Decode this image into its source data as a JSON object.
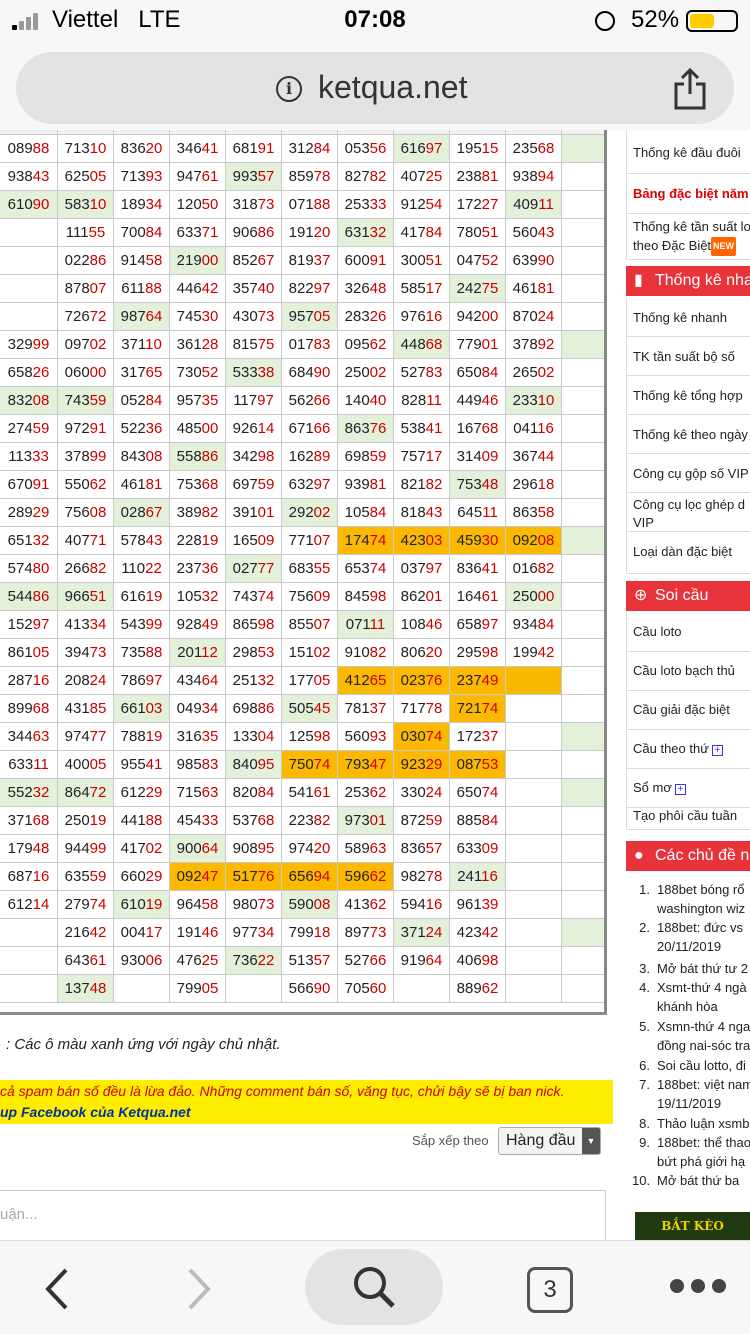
{
  "status_bar": {
    "carrier": "Viettel",
    "network": "LTE",
    "time": "07:08",
    "battery": "52%"
  },
  "url_bar": {
    "host": "ketqua.net"
  },
  "grid_rows": [
    [
      "08988",
      "71310",
      "83620",
      "34641",
      "68191",
      "31284",
      "05356",
      "61697",
      "19515",
      "23568",
      ""
    ],
    [
      "93843",
      "62505",
      "71393",
      "94761",
      "99357",
      "85978",
      "82782",
      "40725",
      "23881",
      "93894",
      ""
    ],
    [
      "61090",
      "58310",
      "18934",
      "12050",
      "31873",
      "07188",
      "25333",
      "91254",
      "17227",
      "40911",
      ""
    ],
    [
      "",
      "11155",
      "70084",
      "63371",
      "90686",
      "19120",
      "63132",
      "41784",
      "78051",
      "56043",
      ""
    ],
    [
      "",
      "02286",
      "91458",
      "21900",
      "85267",
      "81937",
      "60091",
      "30051",
      "04752",
      "63990",
      ""
    ],
    [
      "",
      "87807",
      "61188",
      "44642",
      "35740",
      "82297",
      "32648",
      "58517",
      "24275",
      "46181",
      ""
    ],
    [
      "",
      "72672",
      "98764",
      "74530",
      "43073",
      "95705",
      "28326",
      "97616",
      "94200",
      "87024",
      ""
    ],
    [
      "32999",
      "09702",
      "37110",
      "36128",
      "81575",
      "01783",
      "09562",
      "44868",
      "77901",
      "37892",
      ""
    ],
    [
      "65826",
      "06000",
      "31765",
      "73052",
      "53338",
      "68490",
      "25002",
      "52783",
      "65084",
      "26502",
      ""
    ],
    [
      "83208",
      "74359",
      "05284",
      "95735",
      "11797",
      "56266",
      "14040",
      "82811",
      "44946",
      "23310",
      ""
    ],
    [
      "27459",
      "97291",
      "52236",
      "48500",
      "92614",
      "67166",
      "86376",
      "53841",
      "16768",
      "04116",
      ""
    ],
    [
      "11333",
      "37899",
      "84308",
      "55886",
      "34298",
      "16289",
      "69859",
      "75717",
      "31409",
      "36744",
      ""
    ],
    [
      "67091",
      "55062",
      "46181",
      "75368",
      "69759",
      "63297",
      "93981",
      "82182",
      "75348",
      "29618",
      ""
    ],
    [
      "28929",
      "75608",
      "02867",
      "38982",
      "39101",
      "29202",
      "10584",
      "81843",
      "64511",
      "86358",
      ""
    ],
    [
      "65132",
      "40771",
      "57843",
      "22819",
      "16509",
      "77107",
      "17474",
      "42303",
      "45930",
      "09208",
      ""
    ],
    [
      "57480",
      "26682",
      "11022",
      "23736",
      "02777",
      "68355",
      "65374",
      "03797",
      "83641",
      "01682",
      ""
    ],
    [
      "54486",
      "96651",
      "61619",
      "10532",
      "74374",
      "75609",
      "84598",
      "86201",
      "16461",
      "25000",
      ""
    ],
    [
      "15297",
      "41334",
      "54399",
      "92849",
      "86598",
      "85507",
      "07111",
      "10846",
      "65897",
      "93484",
      ""
    ],
    [
      "86105",
      "39473",
      "73588",
      "20112",
      "29853",
      "15102",
      "91082",
      "80620",
      "29598",
      "19942",
      ""
    ],
    [
      "28716",
      "20824",
      "78697",
      "43464",
      "25132",
      "17705",
      "41265",
      "02376",
      "23749",
      "",
      ""
    ],
    [
      "89968",
      "43185",
      "66103",
      "04934",
      "69886",
      "50545",
      "78137",
      "71778",
      "72174",
      "",
      ""
    ],
    [
      "34463",
      "97477",
      "78819",
      "31635",
      "13304",
      "12598",
      "56093",
      "03074",
      "17237",
      "",
      ""
    ],
    [
      "63311",
      "40005",
      "95541",
      "98583",
      "84095",
      "75074",
      "79347",
      "92329",
      "08753",
      "",
      ""
    ],
    [
      "55232",
      "86472",
      "61229",
      "71563",
      "82084",
      "54161",
      "25362",
      "33024",
      "65074",
      "",
      ""
    ],
    [
      "37168",
      "25019",
      "44188",
      "45433",
      "53768",
      "22382",
      "97301",
      "87259",
      "88584",
      "",
      ""
    ],
    [
      "17948",
      "94499",
      "41702",
      "90064",
      "90895",
      "97420",
      "58963",
      "83657",
      "63309",
      "",
      ""
    ],
    [
      "68716",
      "63559",
      "66029",
      "09247",
      "51776",
      "65694",
      "59662",
      "98278",
      "24116",
      "",
      ""
    ],
    [
      "61214",
      "27974",
      "61019",
      "96458",
      "98073",
      "59008",
      "41362",
      "59416",
      "96139",
      "",
      ""
    ],
    [
      "",
      "21642",
      "00417",
      "19146",
      "97734",
      "79918",
      "89773",
      "37124",
      "42342",
      "",
      ""
    ],
    [
      "",
      "64361",
      "93006",
      "47625",
      "73622",
      "51357",
      "52766",
      "91964",
      "40698",
      "",
      ""
    ],
    [
      "",
      "13748",
      "",
      "79905",
      "",
      "56690",
      "70560",
      "",
      "88962",
      "",
      ""
    ]
  ],
  "grid_green": [
    [
      0,
      7
    ],
    [
      0,
      10
    ],
    [
      1,
      4
    ],
    [
      2,
      0
    ],
    [
      2,
      1
    ],
    [
      2,
      9
    ],
    [
      3,
      6
    ],
    [
      4,
      3
    ],
    [
      5,
      8
    ],
    [
      6,
      2
    ],
    [
      6,
      5
    ],
    [
      7,
      7
    ],
    [
      7,
      10
    ],
    [
      8,
      4
    ],
    [
      9,
      0
    ],
    [
      9,
      1
    ],
    [
      9,
      9
    ],
    [
      10,
      6
    ],
    [
      11,
      3
    ],
    [
      12,
      8
    ],
    [
      13,
      2
    ],
    [
      13,
      5
    ],
    [
      14,
      10
    ],
    [
      15,
      4
    ],
    [
      16,
      0
    ],
    [
      16,
      1
    ],
    [
      16,
      9
    ],
    [
      17,
      6
    ],
    [
      18,
      3
    ],
    [
      20,
      2
    ],
    [
      20,
      5
    ],
    [
      21,
      10
    ],
    [
      22,
      4
    ],
    [
      23,
      0
    ],
    [
      23,
      1
    ],
    [
      23,
      10
    ],
    [
      24,
      6
    ],
    [
      25,
      3
    ],
    [
      26,
      8
    ],
    [
      27,
      2
    ],
    [
      27,
      5
    ],
    [
      28,
      7
    ],
    [
      28,
      10
    ],
    [
      29,
      4
    ],
    [
      30,
      1
    ]
  ],
  "grid_orange": [
    [
      14,
      6
    ],
    [
      14,
      7
    ],
    [
      14,
      8
    ],
    [
      14,
      9
    ],
    [
      19,
      6
    ],
    [
      19,
      7
    ],
    [
      19,
      8
    ],
    [
      19,
      9
    ],
    [
      20,
      8
    ],
    [
      21,
      7
    ],
    [
      22,
      5
    ],
    [
      22,
      6
    ],
    [
      22,
      7
    ],
    [
      22,
      8
    ],
    [
      26,
      3
    ],
    [
      26,
      4
    ],
    [
      26,
      5
    ],
    [
      26,
      6
    ]
  ],
  "note": ": Các ô màu xanh ứng với ngày chủ nhật.",
  "warning": {
    "line1": "cả spam bán số đều là lừa đảo. Những comment bán số, văng tục, chửi bậy sẽ bị ban nick.",
    "line2": "up Facebook của Ketqua.net"
  },
  "sort": {
    "label": "Sắp xếp theo",
    "value": "Hàng đầu"
  },
  "comment": {
    "placeholder": "uận..."
  },
  "sidebar": {
    "top_items": [
      {
        "label": "Thống kê đầu đuôi",
        "red": false
      },
      {
        "label": "Bảng đặc biệt năm",
        "red": true
      },
      {
        "label": "Thống kê tần suất lo",
        "label2": "theo Đặc Biệt",
        "badge": "NEW",
        "red": false
      }
    ],
    "stats_header": "Thống kê nha",
    "stats_items": [
      "Thống kê nhanh",
      "TK tần suất bộ số",
      "Thống kê tổng hợp",
      "Thống kê theo ngày",
      "Công cụ gộp số VIP",
      "Công cụ lọc ghép d"
    ],
    "stats_item_extra": "VIP",
    "stats_last": "Loại dàn đặc biệt",
    "soicau_header": "Soi cầu",
    "soicau_items": [
      {
        "label": "Cầu loto",
        "plus": false
      },
      {
        "label": "Cầu loto bạch thủ",
        "plus": false
      },
      {
        "label": "Cầu giải đặc biệt",
        "plus": false
      },
      {
        "label": "Cầu theo thứ",
        "plus": true
      },
      {
        "label": "Sổ mơ",
        "plus": true
      },
      {
        "label": "Tạo phôi cầu tuần",
        "plus": false
      }
    ],
    "topics_header": "Các chủ đề n",
    "topics": [
      {
        "n": "1.",
        "lines": [
          "188bet bóng rổ",
          "washington wiz"
        ]
      },
      {
        "n": "2.",
        "lines": [
          "188bet: đức vs",
          "20/11/2019"
        ]
      },
      {
        "n": "3.",
        "lines": [
          "Mở bát thứ tư 2"
        ]
      },
      {
        "n": "4.",
        "lines": [
          "Xsmt-thứ 4 ngà",
          "khánh hòa"
        ]
      },
      {
        "n": "5.",
        "lines": [
          "Xsmn-thứ 4 nga",
          "đồng nai-sóc tra"
        ]
      },
      {
        "n": "6.",
        "lines": [
          "Soi cầu lotto, đi"
        ]
      },
      {
        "n": "7.",
        "lines": [
          "188bet: việt nam",
          "19/11/2019"
        ]
      },
      {
        "n": "8.",
        "lines": [
          "Thảo luận xsmb"
        ]
      },
      {
        "n": "9.",
        "lines": [
          "188bet: thể thao",
          "bứt phá giới hạ"
        ]
      },
      {
        "n": "10.",
        "lines": [
          "Mở bát thứ ba"
        ]
      }
    ],
    "banner": "BẮT KÈO"
  },
  "toolbar": {
    "tabs_count": "3"
  }
}
